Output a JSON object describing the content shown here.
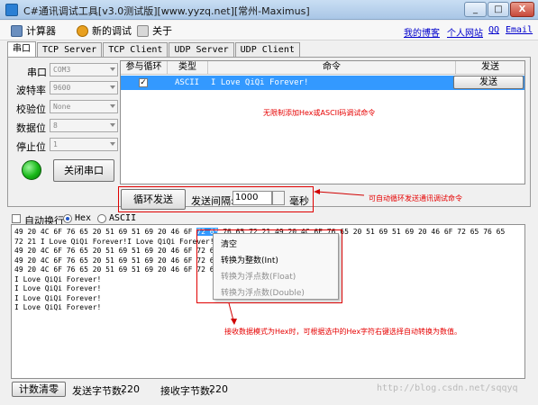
{
  "window": {
    "title": "C#通讯调试工具[v3.0测试版][www.yyzq.net][常州-Maximus]",
    "controls": [
      "_",
      "□",
      "X"
    ]
  },
  "menu": {
    "items": [
      {
        "label": "计算器",
        "icon": "calculator-icon"
      },
      {
        "label": "新的调试",
        "icon": "new-debug-icon"
      },
      {
        "label": "关于",
        "icon": "about-icon"
      }
    ],
    "links": [
      "我的博客",
      "个人网站",
      "QQ",
      "Email"
    ]
  },
  "tabs": [
    "串口",
    "TCP Server",
    "TCP Client",
    "UDP Server",
    "UDP Client"
  ],
  "serial": {
    "fields": [
      {
        "label": "串口",
        "value": "COM3"
      },
      {
        "label": "波特率",
        "value": "9600"
      },
      {
        "label": "校验位",
        "value": "None"
      },
      {
        "label": "数据位",
        "value": "8"
      },
      {
        "label": "停止位",
        "value": "1"
      }
    ],
    "close_port_button": "关闭串口",
    "status_color": "#17b817"
  },
  "command_table": {
    "headers": [
      "参与循环",
      "类型",
      "命令",
      "发送"
    ],
    "rows": [
      {
        "loop": "✓",
        "type": "ASCII",
        "command": "I Love QiQi Forever!",
        "send": "发送"
      }
    ],
    "annotation": "无限制添加Hex或ASCII码调试命令"
  },
  "loop": {
    "button": "循环发送",
    "interval_label": "发送间隔:",
    "interval_value": "1000",
    "unit": "毫秒",
    "annotation": "可自动循环发送通讯调试命令"
  },
  "receive": {
    "auto_wrap_label": "自动换行",
    "mode_hex": "Hex",
    "mode_ascii": "ASCII",
    "line1_pre": "49 20 4C 6F 76 65 20 51 69 51 69 20 46 6F ",
    "line1_sel": "72 65",
    "line1_post": " 76 65 72 21 49 20 4C 6F 76 65 20 51 69 51 69 20 46 6F 72 65 76 65",
    "lines": [
      "72 21 I Love QiQi Forever!I Love QiQi Forever!",
      "49 20 4C 6F 76 65 20 51 69 51 69 20 46 6F 72 65",
      "49 20 4C 6F 76 65 20 51 69 51 69 20 46 6F 72 65",
      "49 20 4C 6F 76 65 20 51 69 51 69 20 46 6F 72 65",
      "I Love QiQi Forever!",
      "I Love QiQi Forever!",
      "I Love QiQi Forever!",
      "I Love QiQi Forever!"
    ],
    "context_menu": [
      "清空",
      "转换为整数(Int)",
      "转换为浮点数(Float)",
      "转换为浮点数(Double)"
    ],
    "annotation": "接收数据模式为Hex时，可根据选中的Hex字符右键选择自动转换为数值。"
  },
  "status": {
    "reset_button": "计数清零",
    "sent_label": "发送字节数:",
    "sent_count": "220",
    "recv_label": "接收字节数:",
    "recv_count": "220",
    "watermark": "http://blog.csdn.net/sqqyq"
  },
  "colors": {
    "selection": "#3399ff",
    "annotation": "#e60000",
    "link": "#0000cc"
  }
}
